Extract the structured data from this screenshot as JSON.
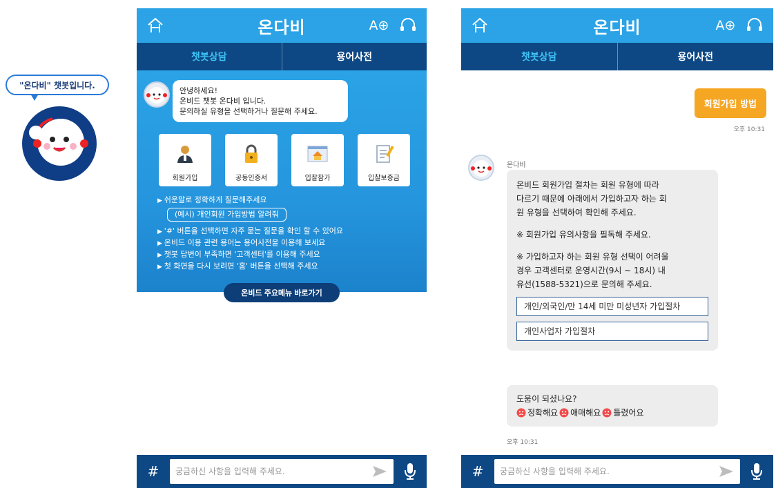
{
  "mascot": {
    "bubble": "\"온다비\" 챗봇입니다."
  },
  "common": {
    "brand": "온다비",
    "font_size_icon": "A⊕",
    "tabs": [
      "챗봇상담",
      "용어사전"
    ],
    "input_placeholder": "궁금하신 사항을 입력해 주세요.",
    "hash": "#",
    "colors": {
      "header": "#2ba3e6",
      "tabbar": "#0d4884",
      "accent_tab": "#3fc2f5",
      "user_bubble": "#f5a623"
    }
  },
  "screen1": {
    "welcome": [
      "안녕하세요!",
      "온비드 챗봇 온다비 입니다.",
      "문의하실 유형을 선택하거나 질문해 주세요."
    ],
    "quick": [
      {
        "label": "회원가입",
        "icon": "user-icon"
      },
      {
        "label": "공동인증서",
        "icon": "lock-icon"
      },
      {
        "label": "입찰참가",
        "icon": "house-icon"
      },
      {
        "label": "입찰보증금",
        "icon": "document-icon"
      }
    ],
    "tip1": "쉬운말로 정확하게 질문해주세요",
    "example": "(예시) 개인회원 가입방법 알려줘",
    "tips": [
      "'#' 버튼을 선택하면 자주 묻는 질문을 확인 할 수 있어요",
      "온비드 이용 관련 용어는 용어사전을 이용해 보세요",
      "챗봇 답변이 부족하면 '고객센터'를 이용해 주세요",
      "첫 화면을 다시 보려면 '홈' 버튼을 선택해 주세요"
    ],
    "shortcut": "온비드 주요메뉴 바로가기"
  },
  "screen2": {
    "user_message": "회원가입 방법",
    "user_time": "오후 10:31",
    "bot_name": "온다비",
    "answer": [
      "온비드 회원가입 절차는 회원 유형에 따라",
      "다르기 때문에 아래에서 가입하고자 하는 회",
      "원 유형을 선택하여 확인해 주세요."
    ],
    "note1": "※ 회원가입 유의사항을 필독해 주세요.",
    "note2": [
      "※ 가입하고자 하는 회원 유형 선택이 어려울",
      "경우 고객센터로 운영시간(9시 ~ 18시) 내",
      "유선(1588-5321)으로 문의해 주세요."
    ],
    "options": [
      "개인/외국인/만 14세 미만 미성년자 가입절차",
      "개인사업자 가입절차"
    ],
    "feedback_q": "도움이 되셨나요?",
    "feedback": [
      "정확해요",
      "애매해요",
      "틀렸어요"
    ],
    "bot_time": "오후 10:31"
  }
}
